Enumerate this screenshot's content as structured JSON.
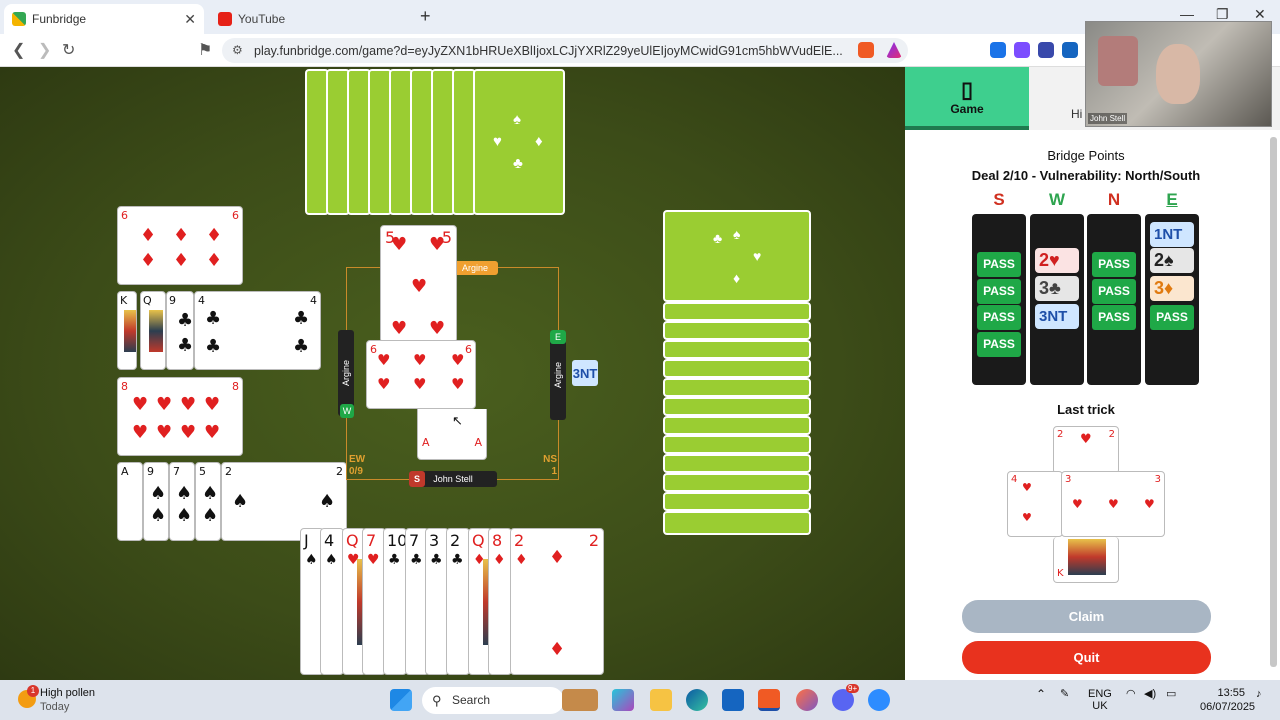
{
  "browser": {
    "tabs": [
      {
        "label": "Funbridge",
        "active": true
      },
      {
        "label": "YouTube",
        "active": false
      }
    ],
    "new_tab": "+",
    "url": "play.funbridge.com/game?d=eyJyZXN1bHRUeXBlIjoxLCJjYXRlZ29yeUlEIjoyMCwidG91cm5hbWVudElE..."
  },
  "game": {
    "north_hand": {
      "back_count": 9
    },
    "west_hand": {
      "diamonds": [
        "6"
      ],
      "clubs": [
        "K",
        "Q",
        "9",
        "4"
      ],
      "hearts": [
        "8"
      ],
      "spades": [
        "A",
        "9",
        "7",
        "5",
        "2"
      ]
    },
    "south_hand": [
      "J",
      "4",
      "Q",
      "7",
      "10",
      "7",
      "3",
      "2",
      "Q",
      "8",
      "2"
    ],
    "trick_cards": {
      "north": "5",
      "west": "6",
      "south": "A"
    },
    "players": {
      "north": "Argine",
      "west": "Argine",
      "east": "Argine",
      "south": "John Stell",
      "west_seat": "W",
      "south_seat": "S"
    },
    "contract_badge": "3NT",
    "score_ew_label": "EW",
    "score_ew": "0/9",
    "score_ns_label": "NS",
    "score_ns": "1"
  },
  "panel": {
    "tab_game": "Game",
    "tab_history": "Hi",
    "title": "Bridge Points",
    "deal_info": "Deal 2/10 - Vulnerability: North/South",
    "bidding_heads": [
      "S",
      "W",
      "N",
      "E"
    ],
    "bids": {
      "S": [
        "PASS",
        "PASS",
        "PASS",
        "PASS"
      ],
      "W": [
        "2♥",
        "3♣",
        "3NT"
      ],
      "N": [
        "PASS",
        "PASS",
        "PASS"
      ],
      "E": [
        "1NT",
        "2♠",
        "3♦",
        "PASS"
      ]
    },
    "last_trick_label": "Last trick",
    "last_trick": {
      "north": "2",
      "west": "4",
      "east": "3",
      "south": "K"
    },
    "claim_label": "Claim",
    "quit_label": "Quit"
  },
  "webcam": {
    "name": "John Stell"
  },
  "taskbar": {
    "weather_badge": "1",
    "weather_title": "High pollen",
    "weather_sub": "Today",
    "search": "Search",
    "notif_badge": "9+",
    "lang": "ENG",
    "region": "UK",
    "time": "13:55",
    "date": "06/07/2025"
  },
  "colors": {
    "felt": "#3c4c18",
    "card_back": "#9acd32",
    "pass_green": "#1fa847",
    "quit_red": "#e8321e",
    "claim_gray": "#a9b6c4",
    "tab_green": "#3ecf8e"
  }
}
